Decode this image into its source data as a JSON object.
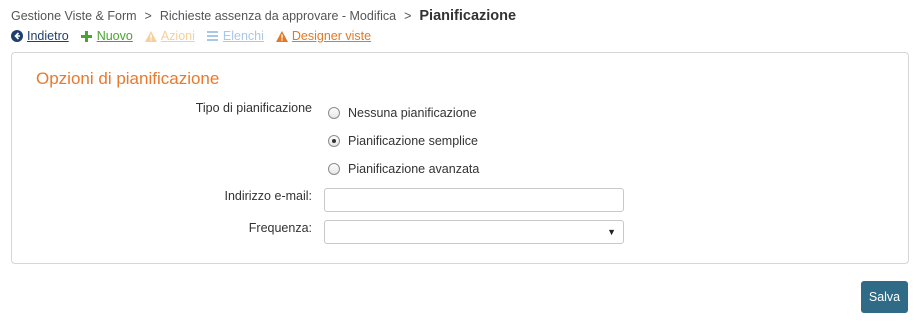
{
  "breadcrumb": {
    "items": [
      "Gestione Viste & Form",
      "Richieste assenza da approvare - Modifica"
    ],
    "separator": ">",
    "current": "Pianificazione"
  },
  "toolbar": {
    "back": {
      "label": "Indietro",
      "icon": "circle-arrow-left-icon",
      "color": "#1f3f6e"
    },
    "new": {
      "label": "Nuovo",
      "icon": "plus-icon",
      "color": "#4aa332"
    },
    "actions": {
      "label": "Azioni",
      "icon": "warning-icon",
      "color": "#f6cf9a"
    },
    "lists": {
      "label": "Elenchi",
      "icon": "list-icon",
      "color": "#a9c8e8"
    },
    "designer": {
      "label": "Designer viste",
      "icon": "warning-icon",
      "color": "#e07a27"
    }
  },
  "panel": {
    "title": "Opzioni di pianificazione",
    "title_color": "#e8792e",
    "schedule_type_label": "Tipo di pianificazione",
    "options": [
      {
        "label": "Nessuna pianificazione",
        "checked": false
      },
      {
        "label": "Pianificazione semplice",
        "checked": true
      },
      {
        "label": "Pianificazione avanzata",
        "checked": false
      }
    ],
    "email_label": "Indirizzo e-mail:",
    "email_value": "",
    "frequency_label": "Frequenza:",
    "frequency_value": ""
  },
  "save_button": {
    "label": "Salva",
    "color": "#2f6b86"
  }
}
